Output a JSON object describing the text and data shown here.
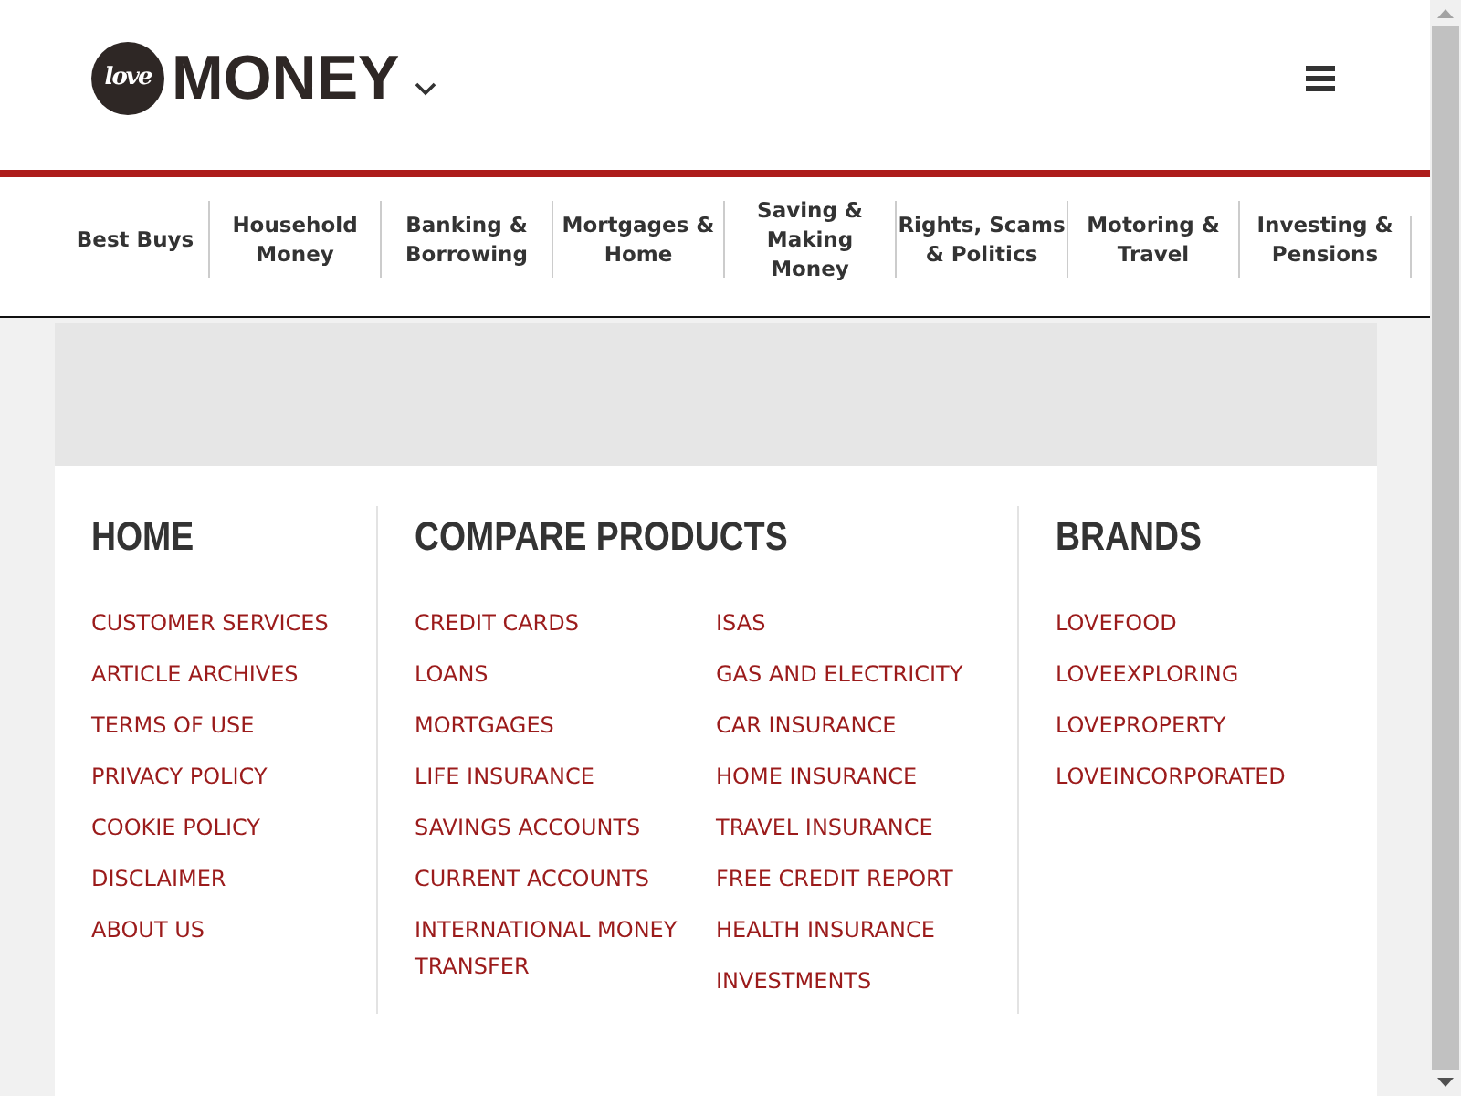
{
  "logo": {
    "badge": "love",
    "word": "MONEY"
  },
  "nav": [
    "Best Buys",
    "Household Money",
    "Banking & Borrowing",
    "Mortgages & Home",
    "Saving & Making Money",
    "Rights, Scams & Politics",
    "Motoring & Travel",
    "Investing & Pensions"
  ],
  "footer": {
    "home": {
      "title": "HOME",
      "links": [
        "CUSTOMER SERVICES",
        "ARTICLE ARCHIVES",
        "TERMS OF USE",
        "PRIVACY POLICY",
        "COOKIE POLICY",
        "DISCLAIMER",
        "ABOUT US"
      ]
    },
    "compare": {
      "title": "COMPARE PRODUCTS",
      "columns": [
        [
          "CREDIT CARDS",
          "LOANS",
          "MORTGAGES",
          "LIFE INSURANCE",
          "SAVINGS ACCOUNTS",
          "CURRENT ACCOUNTS",
          "INTERNATIONAL MONEY TRANSFER"
        ],
        [
          "ISAS",
          "GAS AND ELECTRICITY",
          "CAR INSURANCE",
          "HOME INSURANCE",
          "TRAVEL INSURANCE",
          "FREE CREDIT REPORT",
          "HEALTH INSURANCE",
          "INVESTMENTS"
        ]
      ]
    },
    "brands": {
      "title": "BRANDS",
      "links": [
        "LOVEFOOD",
        "LOVEEXPLORING",
        "LOVEPROPERTY",
        "LOVEINCORPORATED"
      ]
    }
  }
}
